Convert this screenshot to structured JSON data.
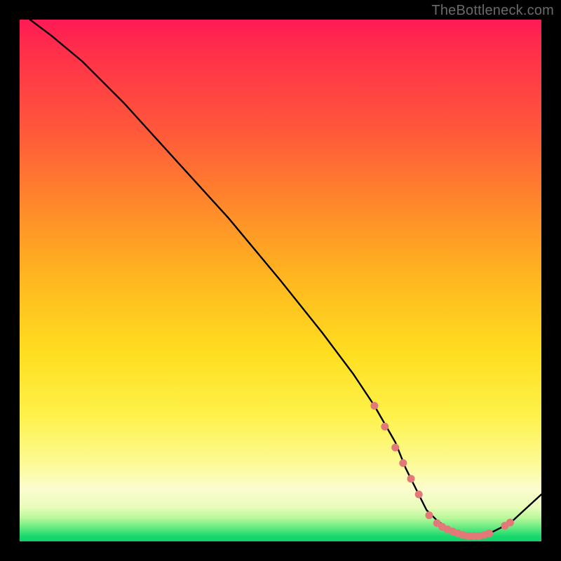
{
  "watermark": "TheBottleneck.com",
  "chart_data": {
    "type": "line",
    "title": "",
    "xlabel": "",
    "ylabel": "",
    "xlim": [
      0,
      100
    ],
    "ylim": [
      0,
      100
    ],
    "grid": false,
    "legend": false,
    "series": [
      {
        "name": "bottleneck-curve",
        "x": [
          2,
          6,
          12,
          20,
          30,
          40,
          50,
          58,
          64,
          68,
          72,
          74,
          76,
          78,
          80,
          82,
          84,
          86,
          88,
          90,
          94,
          100
        ],
        "y": [
          100,
          97,
          92,
          84,
          73,
          62,
          50,
          40,
          32,
          26,
          19,
          14,
          10,
          6,
          4,
          2.5,
          1.5,
          1,
          1,
          1.5,
          3.5,
          9
        ]
      }
    ],
    "markers": {
      "name": "highlight-dots",
      "color": "#e27878",
      "points": [
        {
          "x": 68,
          "y": 26
        },
        {
          "x": 70,
          "y": 22
        },
        {
          "x": 72,
          "y": 18
        },
        {
          "x": 73.5,
          "y": 15
        },
        {
          "x": 75,
          "y": 12
        },
        {
          "x": 76.5,
          "y": 9
        },
        {
          "x": 78.5,
          "y": 5
        },
        {
          "x": 80,
          "y": 3.5
        },
        {
          "x": 81,
          "y": 2.8
        },
        {
          "x": 82,
          "y": 2.3
        },
        {
          "x": 83,
          "y": 1.9
        },
        {
          "x": 84,
          "y": 1.5
        },
        {
          "x": 85,
          "y": 1.2
        },
        {
          "x": 86,
          "y": 1.0
        },
        {
          "x": 87,
          "y": 1.0
        },
        {
          "x": 88,
          "y": 1.0
        },
        {
          "x": 89,
          "y": 1.2
        },
        {
          "x": 90,
          "y": 1.5
        },
        {
          "x": 93,
          "y": 3.0
        },
        {
          "x": 94,
          "y": 3.6
        }
      ]
    },
    "background_gradient": {
      "orientation": "vertical",
      "stops": [
        {
          "pos": 0.0,
          "color": "#ff1a56"
        },
        {
          "pos": 0.22,
          "color": "#ff5a3a"
        },
        {
          "pos": 0.5,
          "color": "#ffb81f"
        },
        {
          "pos": 0.76,
          "color": "#fef24a"
        },
        {
          "pos": 0.9,
          "color": "#fbfccf"
        },
        {
          "pos": 0.975,
          "color": "#5ee97f"
        },
        {
          "pos": 1.0,
          "color": "#0fd168"
        }
      ]
    }
  }
}
